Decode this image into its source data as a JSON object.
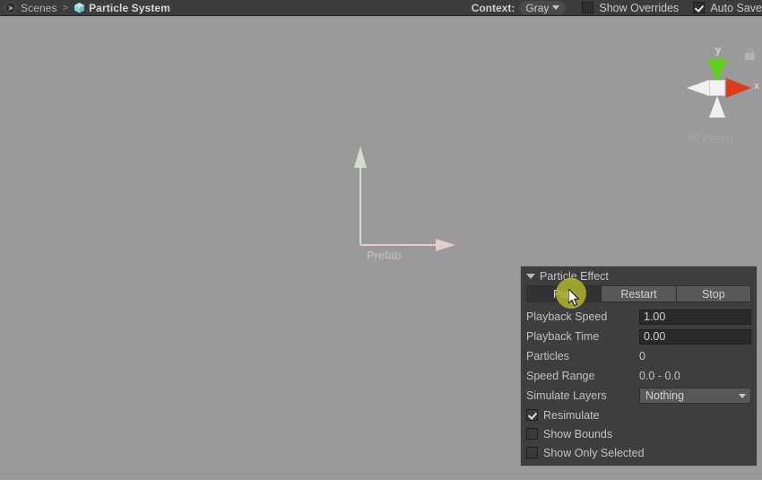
{
  "toolbar": {
    "scene_icon": "scene-icon",
    "breadcrumb_root": "Scenes",
    "breadcrumb_separator": ">",
    "prefab_icon": "prefab-cube-icon",
    "breadcrumb_current": "Particle System",
    "context_label": "Context:",
    "context_value": "Gray",
    "context_caret": "chevron-down-icon",
    "show_overrides_label": "Show Overrides",
    "show_overrides_checked": false,
    "auto_save_label": "Auto Save",
    "auto_save_checked": true
  },
  "scene": {
    "background_color": "#9a9a9a",
    "prefab_gizmo": {
      "label": "Prefab",
      "y_axis_color": "#cfe2c9",
      "x_axis_color": "#e6cdcd"
    },
    "view_gizmo": {
      "y_label": "y",
      "x_label": "x",
      "projection_label": "Persp",
      "projection_chevron": "≪",
      "lock_icon": "lock-icon",
      "y_cone_color": "#5ed020",
      "x_cone_color": "#e03b18",
      "neutral_cone_color": "#f0f0f0"
    }
  },
  "particle_effect": {
    "title": "Particle Effect",
    "foldout_icon": "triangle-down-icon",
    "buttons": [
      {
        "label": "Play",
        "active": true
      },
      {
        "label": "Restart",
        "active": false
      },
      {
        "label": "Stop",
        "active": false
      }
    ],
    "rows": [
      {
        "label": "Playback Speed",
        "value": "1.00",
        "kind": "field"
      },
      {
        "label": "Playback Time",
        "value": "0.00",
        "kind": "field"
      },
      {
        "label": "Particles",
        "value": "0",
        "kind": "text"
      },
      {
        "label": "Speed Range",
        "value": "0.0 - 0.0",
        "kind": "text"
      },
      {
        "label": "Simulate Layers",
        "value": "Nothing",
        "kind": "dropdown"
      }
    ],
    "checkboxes": [
      {
        "label": "Resimulate",
        "checked": true
      },
      {
        "label": "Show Bounds",
        "checked": false
      },
      {
        "label": "Show Only Selected",
        "checked": false
      }
    ]
  },
  "pointer": {
    "click_highlight_color": "#b3bb2b",
    "cursor_icon": "mouse-cursor-icon"
  }
}
